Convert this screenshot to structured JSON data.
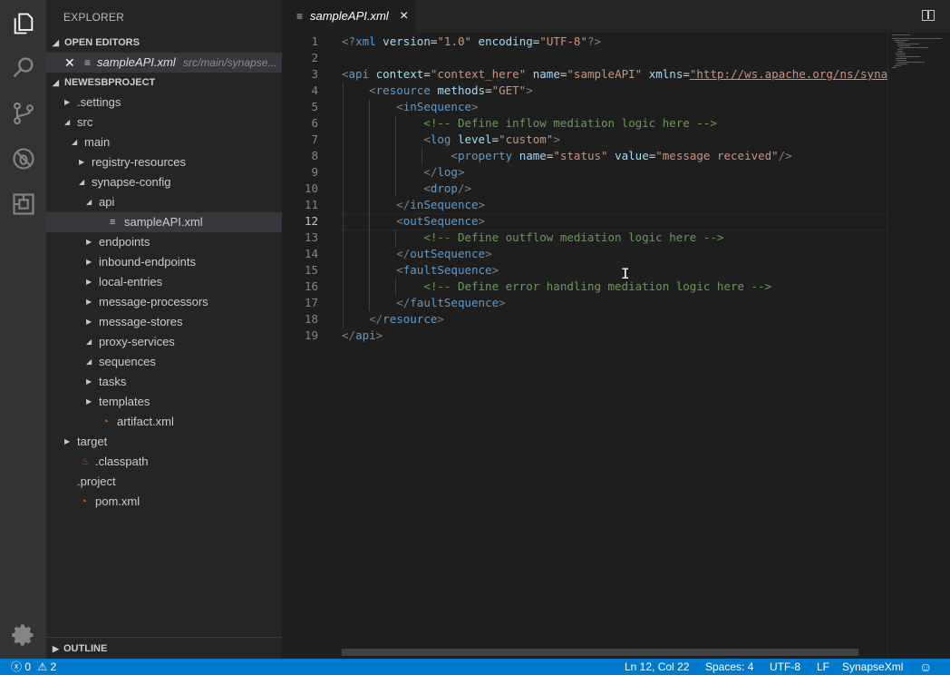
{
  "activity_bar": {
    "items": [
      "explorer-icon",
      "search-icon",
      "source-control-icon",
      "debug-icon",
      "extensions-icon"
    ],
    "bottom": "gear-icon"
  },
  "sidebar": {
    "title": "EXPLORER",
    "open_editors": {
      "header": "OPEN EDITORS",
      "item": {
        "name": "sampleAPI.xml",
        "path": "src/main/synapse..."
      }
    },
    "project": {
      "header": "NEWESBPROJECT"
    },
    "tree": [
      {
        "label": ".settings",
        "twisty": "▶",
        "indent": 0
      },
      {
        "label": "src",
        "twisty": "◢",
        "indent": 0
      },
      {
        "label": "main",
        "twisty": "◢",
        "indent": 1
      },
      {
        "label": "registry-resources",
        "twisty": "▶",
        "indent": 2
      },
      {
        "label": "synapse-config",
        "twisty": "◢",
        "indent": 2
      },
      {
        "label": "api",
        "twisty": "◢",
        "indent": 3
      },
      {
        "label": "sampleAPI.xml",
        "twisty": "",
        "indent": 4,
        "icon": "lines",
        "selected": true
      },
      {
        "label": "endpoints",
        "twisty": "▶",
        "indent": 3
      },
      {
        "label": "inbound-endpoints",
        "twisty": "▶",
        "indent": 3
      },
      {
        "label": "local-entries",
        "twisty": "▶",
        "indent": 3
      },
      {
        "label": "message-processors",
        "twisty": "▶",
        "indent": 3
      },
      {
        "label": "message-stores",
        "twisty": "▶",
        "indent": 3
      },
      {
        "label": "proxy-services",
        "twisty": "◢",
        "indent": 3
      },
      {
        "label": "sequences",
        "twisty": "◢",
        "indent": 3
      },
      {
        "label": "tasks",
        "twisty": "▶",
        "indent": 3
      },
      {
        "label": "templates",
        "twisty": "▶",
        "indent": 3
      },
      {
        "label": "artifact.xml",
        "twisty": "",
        "indent": 3,
        "icon": "rss"
      },
      {
        "label": "target",
        "twisty": "▶",
        "indent": 0
      },
      {
        "label": ".classpath",
        "twisty": "",
        "indent": 0,
        "icon": "java"
      },
      {
        "label": ".project",
        "twisty": "",
        "indent": 0,
        "icon": "none"
      },
      {
        "label": "pom.xml",
        "twisty": "",
        "indent": 0,
        "icon": "rss"
      }
    ],
    "outline_header": "OUTLINE"
  },
  "editor": {
    "tab": {
      "name": "sampleAPI.xml",
      "close": "×"
    },
    "active_line": 12,
    "lines": [
      [
        [
          "p",
          "<?"
        ],
        [
          "t",
          "xml"
        ],
        [
          "a",
          " version"
        ],
        [
          "d",
          "="
        ],
        [
          "s",
          "\"1.0\""
        ],
        [
          "a",
          " encoding"
        ],
        [
          "d",
          "="
        ],
        [
          "s",
          "\"UTF-8\""
        ],
        [
          "p",
          "?>"
        ]
      ],
      [],
      [
        [
          "p",
          "<"
        ],
        [
          "t",
          "api"
        ],
        [
          "a",
          " context"
        ],
        [
          "d",
          "="
        ],
        [
          "s",
          "\"context_here\""
        ],
        [
          "a",
          " name"
        ],
        [
          "d",
          "="
        ],
        [
          "s",
          "\"sampleAPI\""
        ],
        [
          "a",
          " xmlns"
        ],
        [
          "d",
          "="
        ],
        [
          "s",
          "\"http://ws.apache.org/ns/synapse\""
        ]
      ],
      [
        [
          "d",
          "    "
        ],
        [
          "p",
          "<"
        ],
        [
          "t",
          "resource"
        ],
        [
          "a",
          " methods"
        ],
        [
          "d",
          "="
        ],
        [
          "s",
          "\"GET\""
        ],
        [
          "p",
          ">"
        ]
      ],
      [
        [
          "d",
          "        "
        ],
        [
          "p",
          "<"
        ],
        [
          "t",
          "inSequence"
        ],
        [
          "p",
          ">"
        ]
      ],
      [
        [
          "d",
          "            "
        ],
        [
          "c",
          "<!-- Define inflow mediation logic here -->"
        ]
      ],
      [
        [
          "d",
          "            "
        ],
        [
          "p",
          "<"
        ],
        [
          "t",
          "log"
        ],
        [
          "a",
          " level"
        ],
        [
          "d",
          "="
        ],
        [
          "s",
          "\"custom\""
        ],
        [
          "p",
          ">"
        ]
      ],
      [
        [
          "d",
          "                "
        ],
        [
          "p",
          "<"
        ],
        [
          "t",
          "property"
        ],
        [
          "a",
          " name"
        ],
        [
          "d",
          "="
        ],
        [
          "s",
          "\"status\""
        ],
        [
          "a",
          " value"
        ],
        [
          "d",
          "="
        ],
        [
          "s",
          "\"message received\""
        ],
        [
          "p",
          "/>"
        ]
      ],
      [
        [
          "d",
          "            "
        ],
        [
          "p",
          "</"
        ],
        [
          "t",
          "log"
        ],
        [
          "p",
          ">"
        ]
      ],
      [
        [
          "d",
          "            "
        ],
        [
          "p",
          "<"
        ],
        [
          "t",
          "drop"
        ],
        [
          "p",
          "/>"
        ]
      ],
      [
        [
          "d",
          "        "
        ],
        [
          "p",
          "</"
        ],
        [
          "t",
          "inSequence"
        ],
        [
          "p",
          ">"
        ]
      ],
      [
        [
          "d",
          "        "
        ],
        [
          "p",
          "<"
        ],
        [
          "t",
          "outSequence"
        ],
        [
          "p",
          ">"
        ]
      ],
      [
        [
          "d",
          "            "
        ],
        [
          "c",
          "<!-- Define outflow mediation logic here -->"
        ]
      ],
      [
        [
          "d",
          "        "
        ],
        [
          "p",
          "</"
        ],
        [
          "t",
          "outSequence"
        ],
        [
          "p",
          ">"
        ]
      ],
      [
        [
          "d",
          "        "
        ],
        [
          "p",
          "<"
        ],
        [
          "t",
          "faultSequence"
        ],
        [
          "p",
          ">"
        ]
      ],
      [
        [
          "d",
          "            "
        ],
        [
          "c",
          "<!-- Define error handling mediation logic here -->"
        ]
      ],
      [
        [
          "d",
          "        "
        ],
        [
          "p",
          "</"
        ],
        [
          "t",
          "faultSequence"
        ],
        [
          "p",
          ">"
        ]
      ],
      [
        [
          "d",
          "    "
        ],
        [
          "p",
          "</"
        ],
        [
          "t",
          "resource"
        ],
        [
          "p",
          ">"
        ]
      ],
      [
        [
          "p",
          "</"
        ],
        [
          "t",
          "api"
        ],
        [
          "p",
          ">"
        ]
      ]
    ]
  },
  "status_bar": {
    "errors": "0",
    "warnings": "2",
    "cursor": "Ln 12, Col 22",
    "spaces": "Spaces: 4",
    "encoding": "UTF-8",
    "eol": "LF",
    "language": "SynapseXml"
  },
  "colors": {
    "accent": "#007acc",
    "tag": "#569cd6",
    "attr": "#9cdcfe",
    "string": "#ce9178",
    "comment": "#6a9955"
  }
}
